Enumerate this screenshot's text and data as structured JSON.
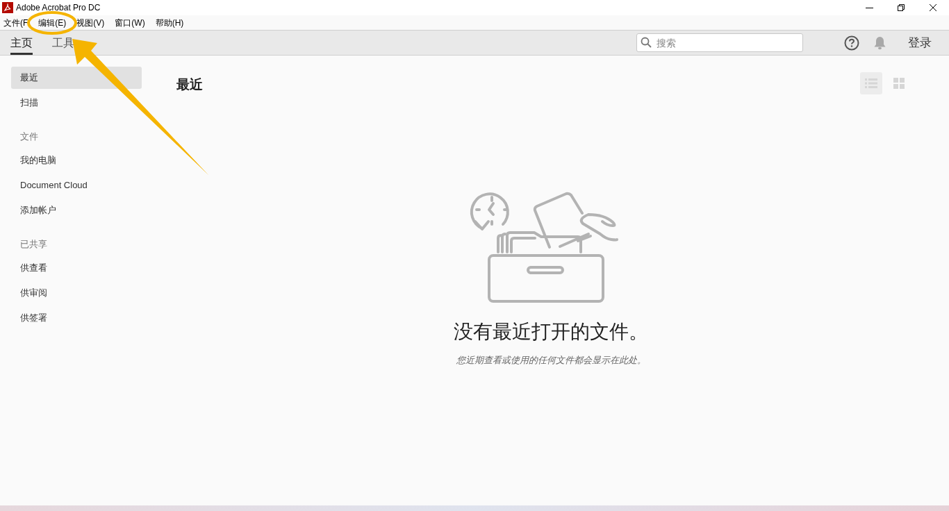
{
  "window": {
    "title": "Adobe Acrobat Pro DC"
  },
  "menu": [
    "文件(F",
    "编辑(E)",
    "视图(V)",
    "窗口(W)",
    "帮助(H)"
  ],
  "tabs": [
    {
      "label": "主页",
      "selected": true
    },
    {
      "label": "工具",
      "selected": false
    }
  ],
  "search": {
    "placeholder": "搜索"
  },
  "sign_in": "登录",
  "sidebar": [
    {
      "kind": "item",
      "label": "最近",
      "selected": true
    },
    {
      "kind": "item",
      "label": "扫描",
      "selected": false
    },
    {
      "kind": "heading",
      "label": "文件"
    },
    {
      "kind": "item",
      "label": "我的电脑",
      "selected": false
    },
    {
      "kind": "item",
      "label": "Document Cloud",
      "selected": false
    },
    {
      "kind": "item",
      "label": "添加帐户",
      "selected": false
    },
    {
      "kind": "heading",
      "label": "已共享"
    },
    {
      "kind": "item",
      "label": "供查看",
      "selected": false
    },
    {
      "kind": "item",
      "label": "供审阅",
      "selected": false
    },
    {
      "kind": "item",
      "label": "供签署",
      "selected": false
    }
  ],
  "view_modes": [
    {
      "kind": "list",
      "selected": true
    },
    {
      "kind": "grid",
      "selected": false
    }
  ],
  "content": {
    "heading": "最近",
    "empty_title": "没有最近打开的文件。",
    "empty_hint": "您近期查看或使用的任何文件都会显示在此处。"
  }
}
